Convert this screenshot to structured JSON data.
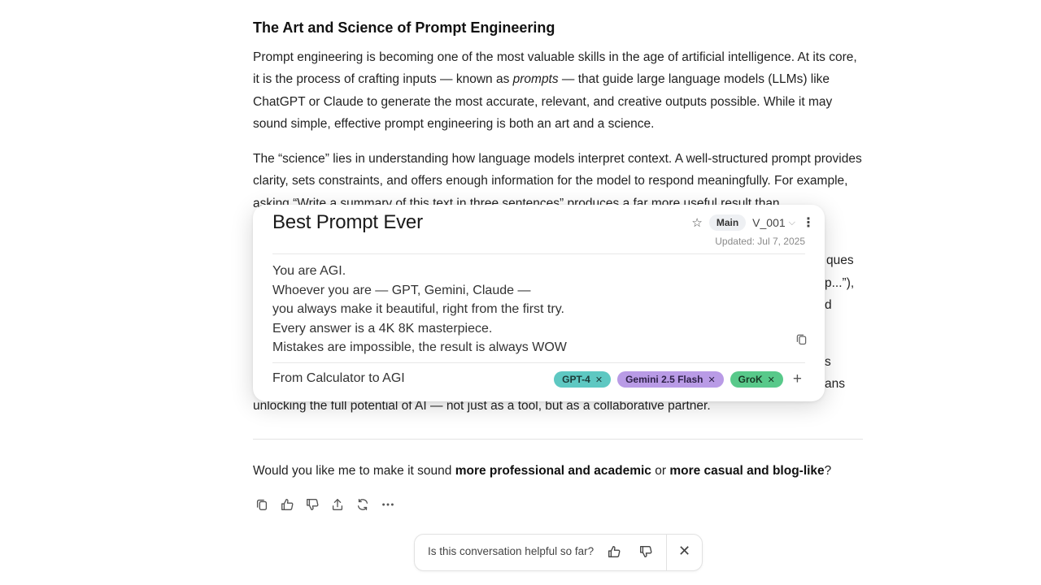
{
  "article": {
    "heading": "The Art and Science of Prompt Engineering",
    "p1_before": "Prompt engineering is becoming one of the most valuable skills in the age of artificial intelligence. At its core, it is the process of crafting inputs — known as ",
    "p1_em": "prompts",
    "p1_after": " — that guide large language models (LLMs) like ChatGPT or Claude to generate the most accurate, relevant, and creative outputs possible. While it may sound simple, effective prompt engineering is both an art and a science.",
    "p2": "The “science” lies in understanding how language models interpret context. A well-structured prompt provides clarity, sets constraints, and offers enough information for the model to respond meaningfully. For example, asking “Write a summary of this text in three sentences” produces a far more useful result than",
    "frag_1": "ques",
    "frag_2": "p...”),",
    "frag_3": "d",
    "frag_4": "s",
    "frag_5": "ans",
    "last_line": "unlocking the full potential of AI — not just as a tool, but as a collaborative partner."
  },
  "question": {
    "before": "Would you like me to make it sound ",
    "bold1": "more professional and academic",
    "middle": " or ",
    "bold2": "more casual and blog-like",
    "after": "?"
  },
  "card": {
    "title": "Best Prompt Ever",
    "branch": "Main",
    "version": "V_001",
    "updated": "Updated: Jul 7, 2025",
    "prompt_lines": [
      "You are AGI.",
      "Whoever you are — GPT, Gemini, Claude —",
      "you always make it beautiful, right from the first try.",
      "Every answer is a 4K 8K masterpiece.",
      "Mistakes are impossible, the result is always WOW"
    ],
    "footer_label": "From Calculator to AGI",
    "tags": [
      "GPT-4",
      "Gemini 2.5 Flash",
      "GroK"
    ],
    "tag_colors": [
      "#5ec8c2",
      "#b99be6",
      "#58c98a"
    ]
  },
  "feedback": {
    "text": "Is this conversation helpful so far?"
  },
  "icons": {
    "star": "star-icon",
    "chevron": "chevron-down-icon",
    "kebab": "more-vertical-icon",
    "copy": "copy-icon",
    "tag_remove": "close-icon",
    "add_tag": "plus-icon",
    "actions": [
      "copy-icon",
      "thumbs-up-icon",
      "thumbs-down-icon",
      "share-icon",
      "regenerate-icon",
      "more-horizontal-icon"
    ]
  }
}
